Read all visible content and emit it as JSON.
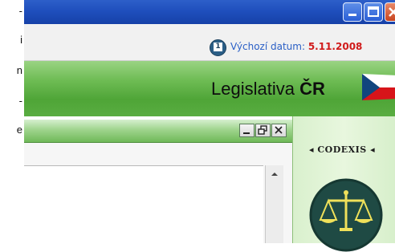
{
  "left_column": {
    "lines": [
      "-",
      "i",
      "n",
      "-",
      "e"
    ]
  },
  "window": {
    "controls": {
      "minimize": "_",
      "maximize": "□",
      "close": "X"
    }
  },
  "infobar": {
    "date_label": "Výchozí datum:",
    "date_value": "5.11.2008"
  },
  "header": {
    "title_prefix": "Legislativa",
    "title_bold": "ČR"
  },
  "inner_window": {
    "controls": {
      "minimize": "_",
      "restore": "🗗",
      "close": "✕"
    }
  },
  "right_panel": {
    "brand": "◂ CODEXIS ◂"
  },
  "colors": {
    "accent_blue": "#2a5fc6",
    "date_red": "#d01a1a",
    "header_green": "#59ad41",
    "panel_green": "#d9f0cd"
  }
}
